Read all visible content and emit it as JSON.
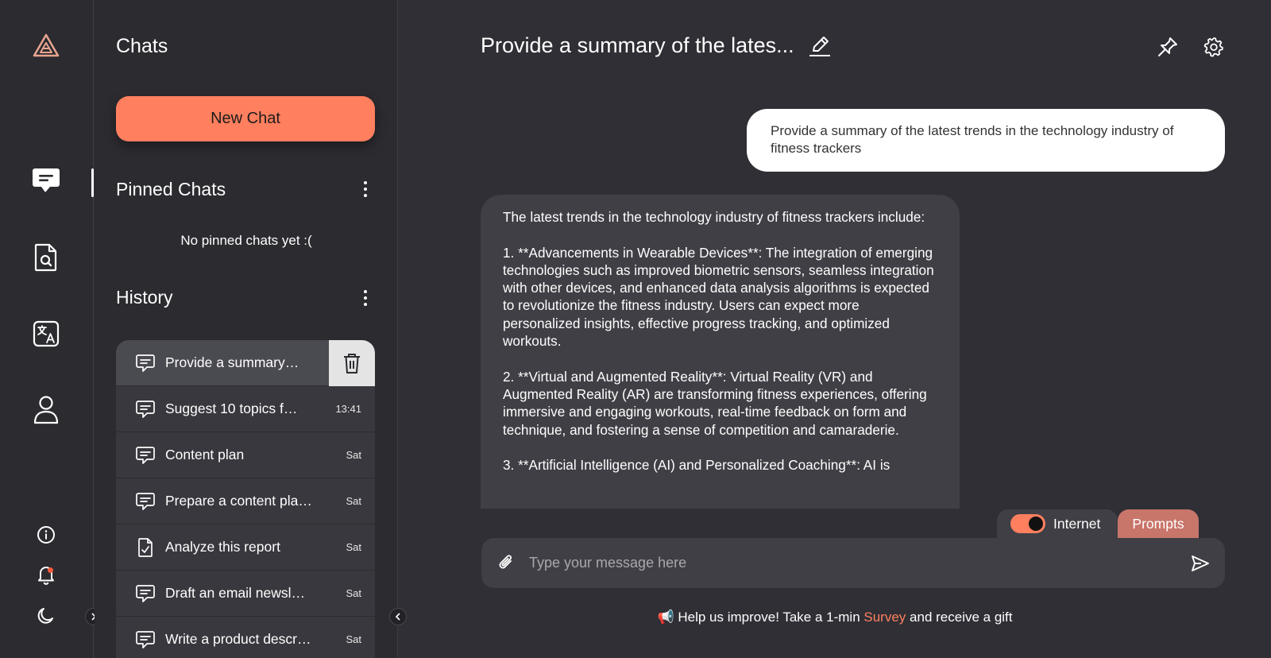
{
  "sidebar": {
    "title": "Chats",
    "new_chat_label": "New Chat",
    "pinned_title": "Pinned Chats",
    "pinned_empty": "No pinned chats yet :(",
    "history_title": "History",
    "history": [
      {
        "label": "Provide a summary…",
        "time": "",
        "icon": "chat-icon",
        "active": true
      },
      {
        "label": "Suggest 10 topics f…",
        "time": "13:41",
        "icon": "chat-icon"
      },
      {
        "label": "Content plan",
        "time": "Sat",
        "icon": "chat-icon"
      },
      {
        "label": "Prepare a content pla…",
        "time": "Sat",
        "icon": "chat-icon"
      },
      {
        "label": "Analyze this report",
        "time": "Sat",
        "icon": "document-check-icon"
      },
      {
        "label": "Draft an email newsl…",
        "time": "Sat",
        "icon": "chat-icon"
      },
      {
        "label": "Write a product descr…",
        "time": "Sat",
        "icon": "chat-icon"
      }
    ]
  },
  "chat": {
    "title": "Provide a summary of the lates...",
    "user_message": "Provide a summary of the latest trends in the technology industry of fitness trackers",
    "bot_paragraphs": [
      "The latest trends in the technology industry of fitness trackers include:",
      "1. **Advancements in Wearable Devices**: The integration of emerging technologies such as improved biometric sensors, seamless integration with other devices, and enhanced data analysis algorithms is expected to revolutionize the fitness industry. Users can expect more personalized insights, effective progress tracking, and optimized workouts.",
      "2. **Virtual and Augmented Reality**: Virtual Reality (VR) and Augmented Reality (AR) are transforming fitness experiences, offering immersive and engaging workouts, real-time feedback on form and technique, and fostering a sense of competition and camaraderie.",
      "3. **Artificial Intelligence (AI) and Personalized Coaching**: AI is"
    ]
  },
  "composer": {
    "internet_label": "Internet",
    "internet_on": true,
    "prompts_label": "Prompts",
    "placeholder": "Type your message here"
  },
  "survey": {
    "icon": "📢",
    "prefix": "Help us improve! Take a 1-min ",
    "link": "Survey",
    "suffix": " and receive a gift"
  },
  "colors": {
    "accent": "#ff7f5e",
    "prompts_tab": "#c8756a",
    "background": "#2f2f35",
    "panel": "#2b2b30"
  }
}
